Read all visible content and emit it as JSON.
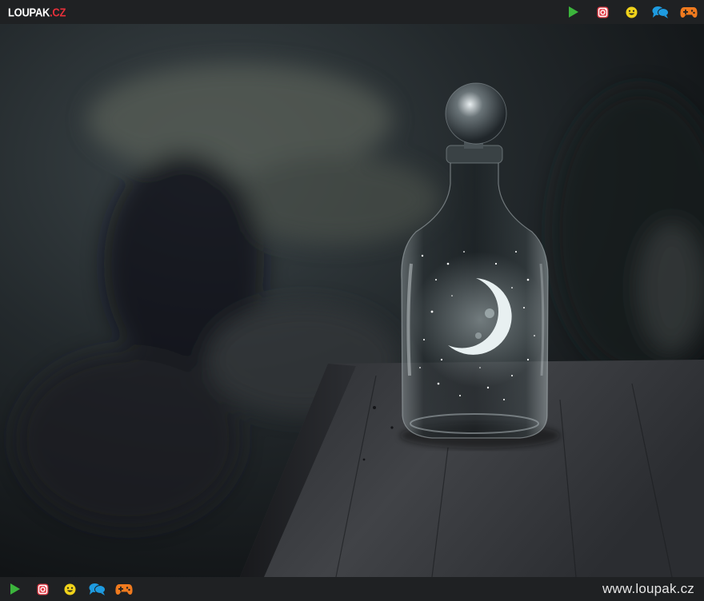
{
  "header": {
    "logo_main": "LOUPAK",
    "logo_tld": ".CZ",
    "icons": [
      "play-icon",
      "instagram-icon",
      "smiley-icon",
      "chat-icon",
      "gamepad-icon"
    ]
  },
  "footer": {
    "site_link": "www.loupak.cz",
    "icons": [
      "play-icon",
      "instagram-icon",
      "smiley-icon",
      "chat-icon",
      "gamepad-icon"
    ]
  },
  "colors": {
    "bar_bg": "#1f2123",
    "brand_red": "#e8303a",
    "play_green": "#3cb53c",
    "instagram_red": "#e23b45",
    "smiley_yellow": "#f0d21a",
    "chat_blue": "#1e9be0",
    "gamepad_orange": "#f07a1e"
  }
}
